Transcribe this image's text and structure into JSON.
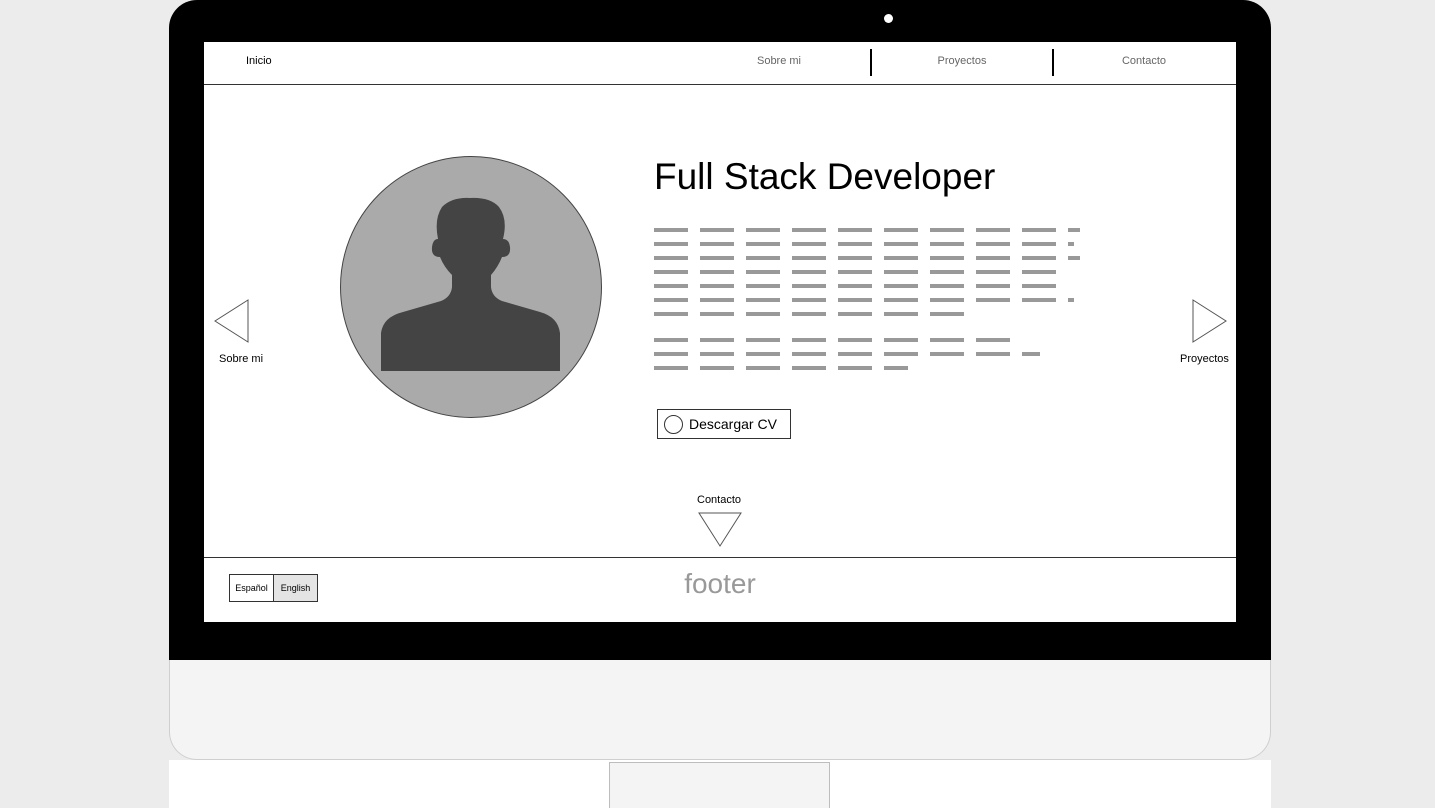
{
  "nav": {
    "home": "Inicio",
    "items": [
      "Sobre mi",
      "Proyectos",
      "Contacto"
    ]
  },
  "hero": {
    "title": "Full Stack Developer",
    "download_cv": "Descargar CV"
  },
  "arrows": {
    "left_label": "Sobre mi",
    "right_label": "Proyectos",
    "down_label": "Contacto"
  },
  "footer": {
    "text": "footer",
    "lang_es": "Español",
    "lang_en": "English"
  },
  "colors": {
    "bezel": "#000000",
    "avatar_bg": "#aaaaaa",
    "avatar_silhouette": "#444444",
    "placeholder_text": "#999999"
  }
}
